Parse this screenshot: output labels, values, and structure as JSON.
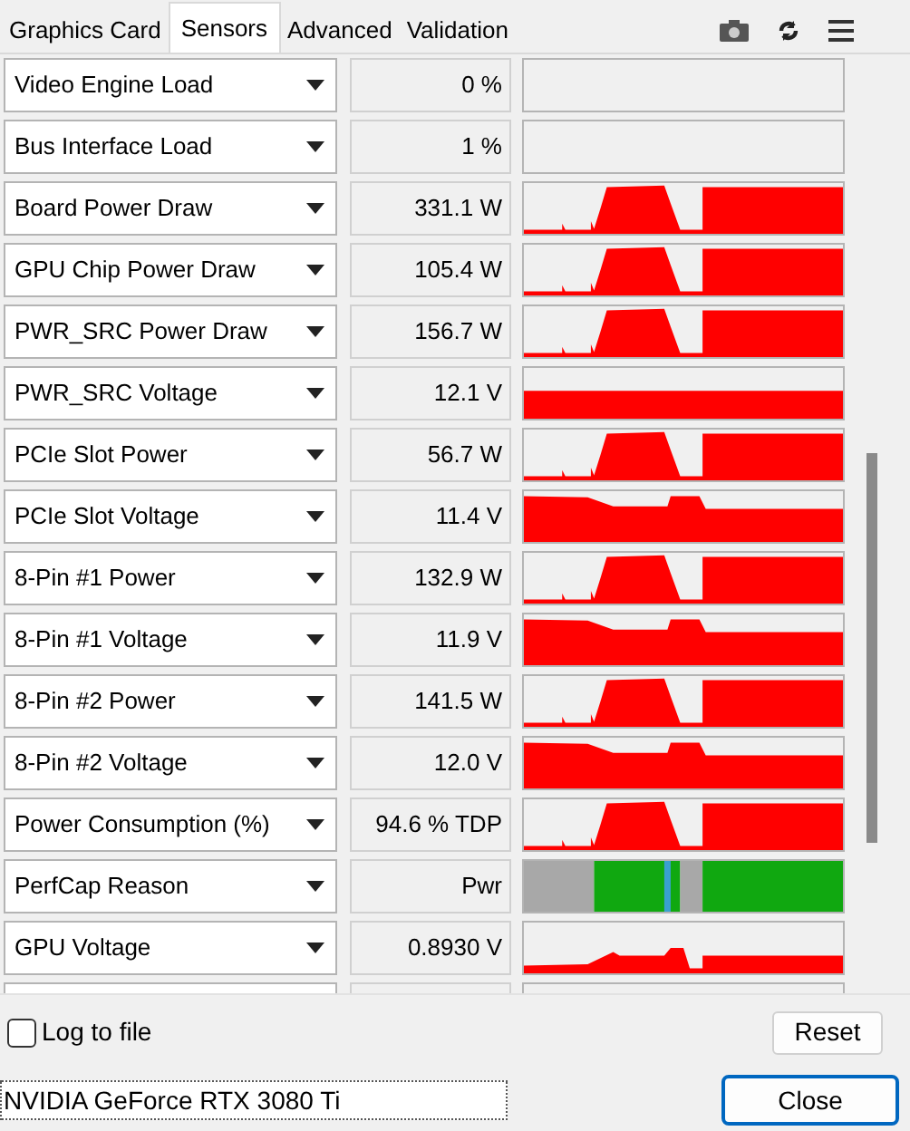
{
  "tabs": [
    {
      "label": "Graphics Card",
      "selected": false
    },
    {
      "label": "Sensors",
      "selected": true
    },
    {
      "label": "Advanced",
      "selected": false
    },
    {
      "label": "Validation",
      "selected": false
    }
  ],
  "sensors": [
    {
      "name": "Video Engine Load",
      "value": "0 %",
      "kind": "empty"
    },
    {
      "name": "Bus Interface Load",
      "value": "1 %",
      "kind": "empty"
    },
    {
      "name": "Board Power Draw",
      "value": "331.1 W",
      "kind": "burst"
    },
    {
      "name": "GPU Chip Power Draw",
      "value": "105.4 W",
      "kind": "burst"
    },
    {
      "name": "PWR_SRC Power Draw",
      "value": "156.7 W",
      "kind": "burst"
    },
    {
      "name": "PWR_SRC Voltage",
      "value": "12.1 V",
      "kind": "flat"
    },
    {
      "name": "PCIe Slot Power",
      "value": "56.7 W",
      "kind": "burst"
    },
    {
      "name": "PCIe Slot Voltage",
      "value": "11.4 V",
      "kind": "dip"
    },
    {
      "name": "8-Pin #1 Power",
      "value": "132.9 W",
      "kind": "burst"
    },
    {
      "name": "8-Pin #1 Voltage",
      "value": "11.9 V",
      "kind": "dip"
    },
    {
      "name": "8-Pin #2 Power",
      "value": "141.5 W",
      "kind": "burst"
    },
    {
      "name": "8-Pin #2 Voltage",
      "value": "12.0 V",
      "kind": "dip"
    },
    {
      "name": "Power Consumption (%)",
      "value": "94.6 % TDP",
      "kind": "burst"
    },
    {
      "name": "PerfCap Reason",
      "value": "Pwr",
      "kind": "perfcap"
    },
    {
      "name": "GPU Voltage",
      "value": "0.8930 V",
      "kind": "low"
    }
  ],
  "log_to_file": {
    "label": "Log to file",
    "checked": false
  },
  "reset_button": "Reset",
  "device": "NVIDIA GeForce RTX 3080 Ti",
  "close_button": "Close"
}
